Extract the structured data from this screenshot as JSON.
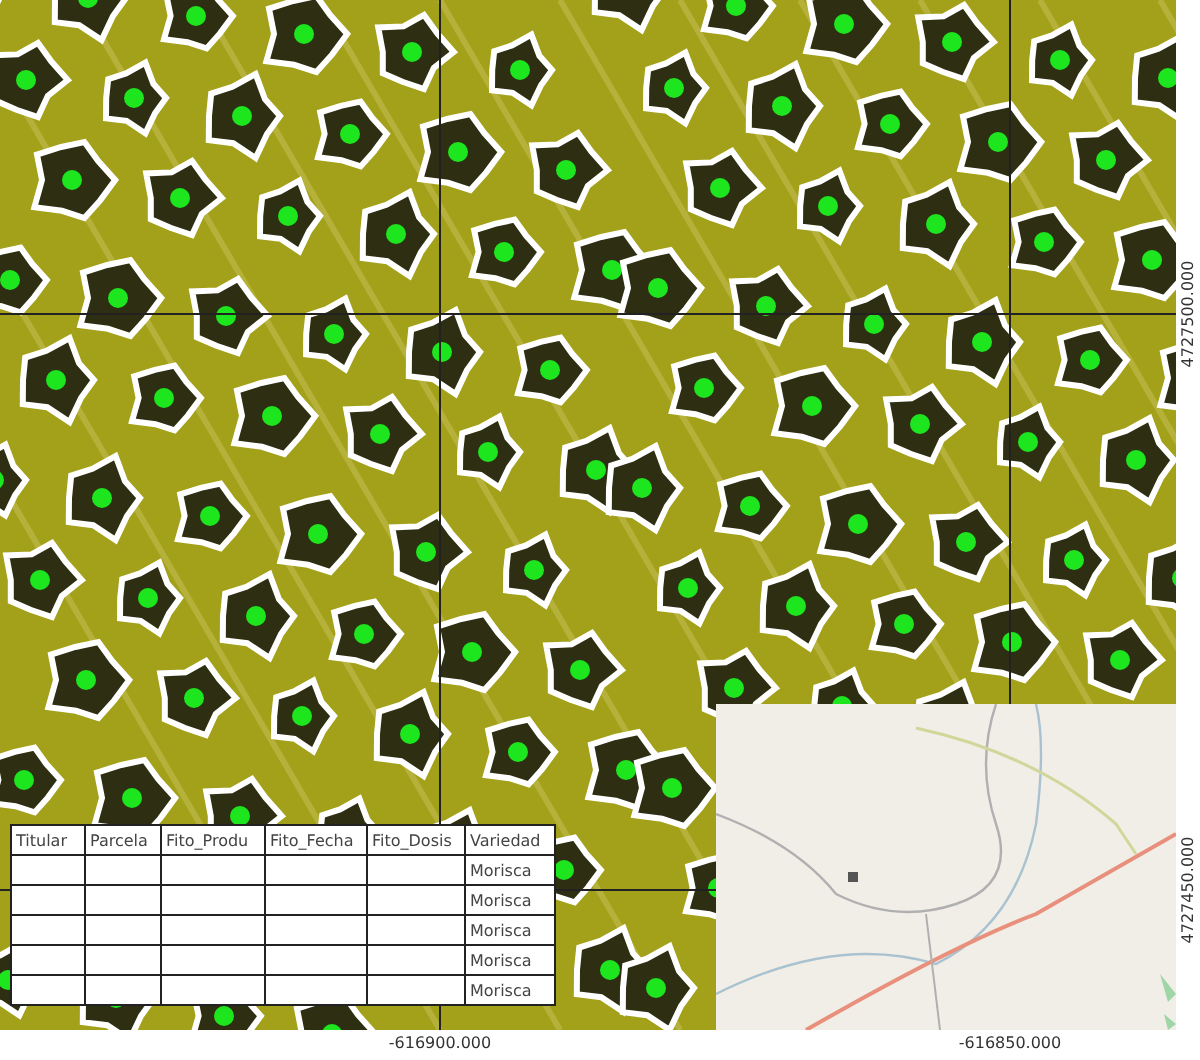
{
  "map": {
    "x_labels": [
      "-616900.000",
      "-616850.000"
    ],
    "y_labels": [
      "4727500.000",
      "4727450.000"
    ]
  },
  "table": {
    "columns": [
      "Titular",
      "Parcela",
      "Fito_Produ",
      "Fito_Fecha",
      "Fito_Dosis",
      "Variedad"
    ],
    "rows": [
      {
        "variedad": "Morisca"
      },
      {
        "variedad": "Morisca"
      },
      {
        "variedad": "Morisca"
      },
      {
        "variedad": "Morisca"
      },
      {
        "variedad": "Morisca"
      }
    ]
  }
}
